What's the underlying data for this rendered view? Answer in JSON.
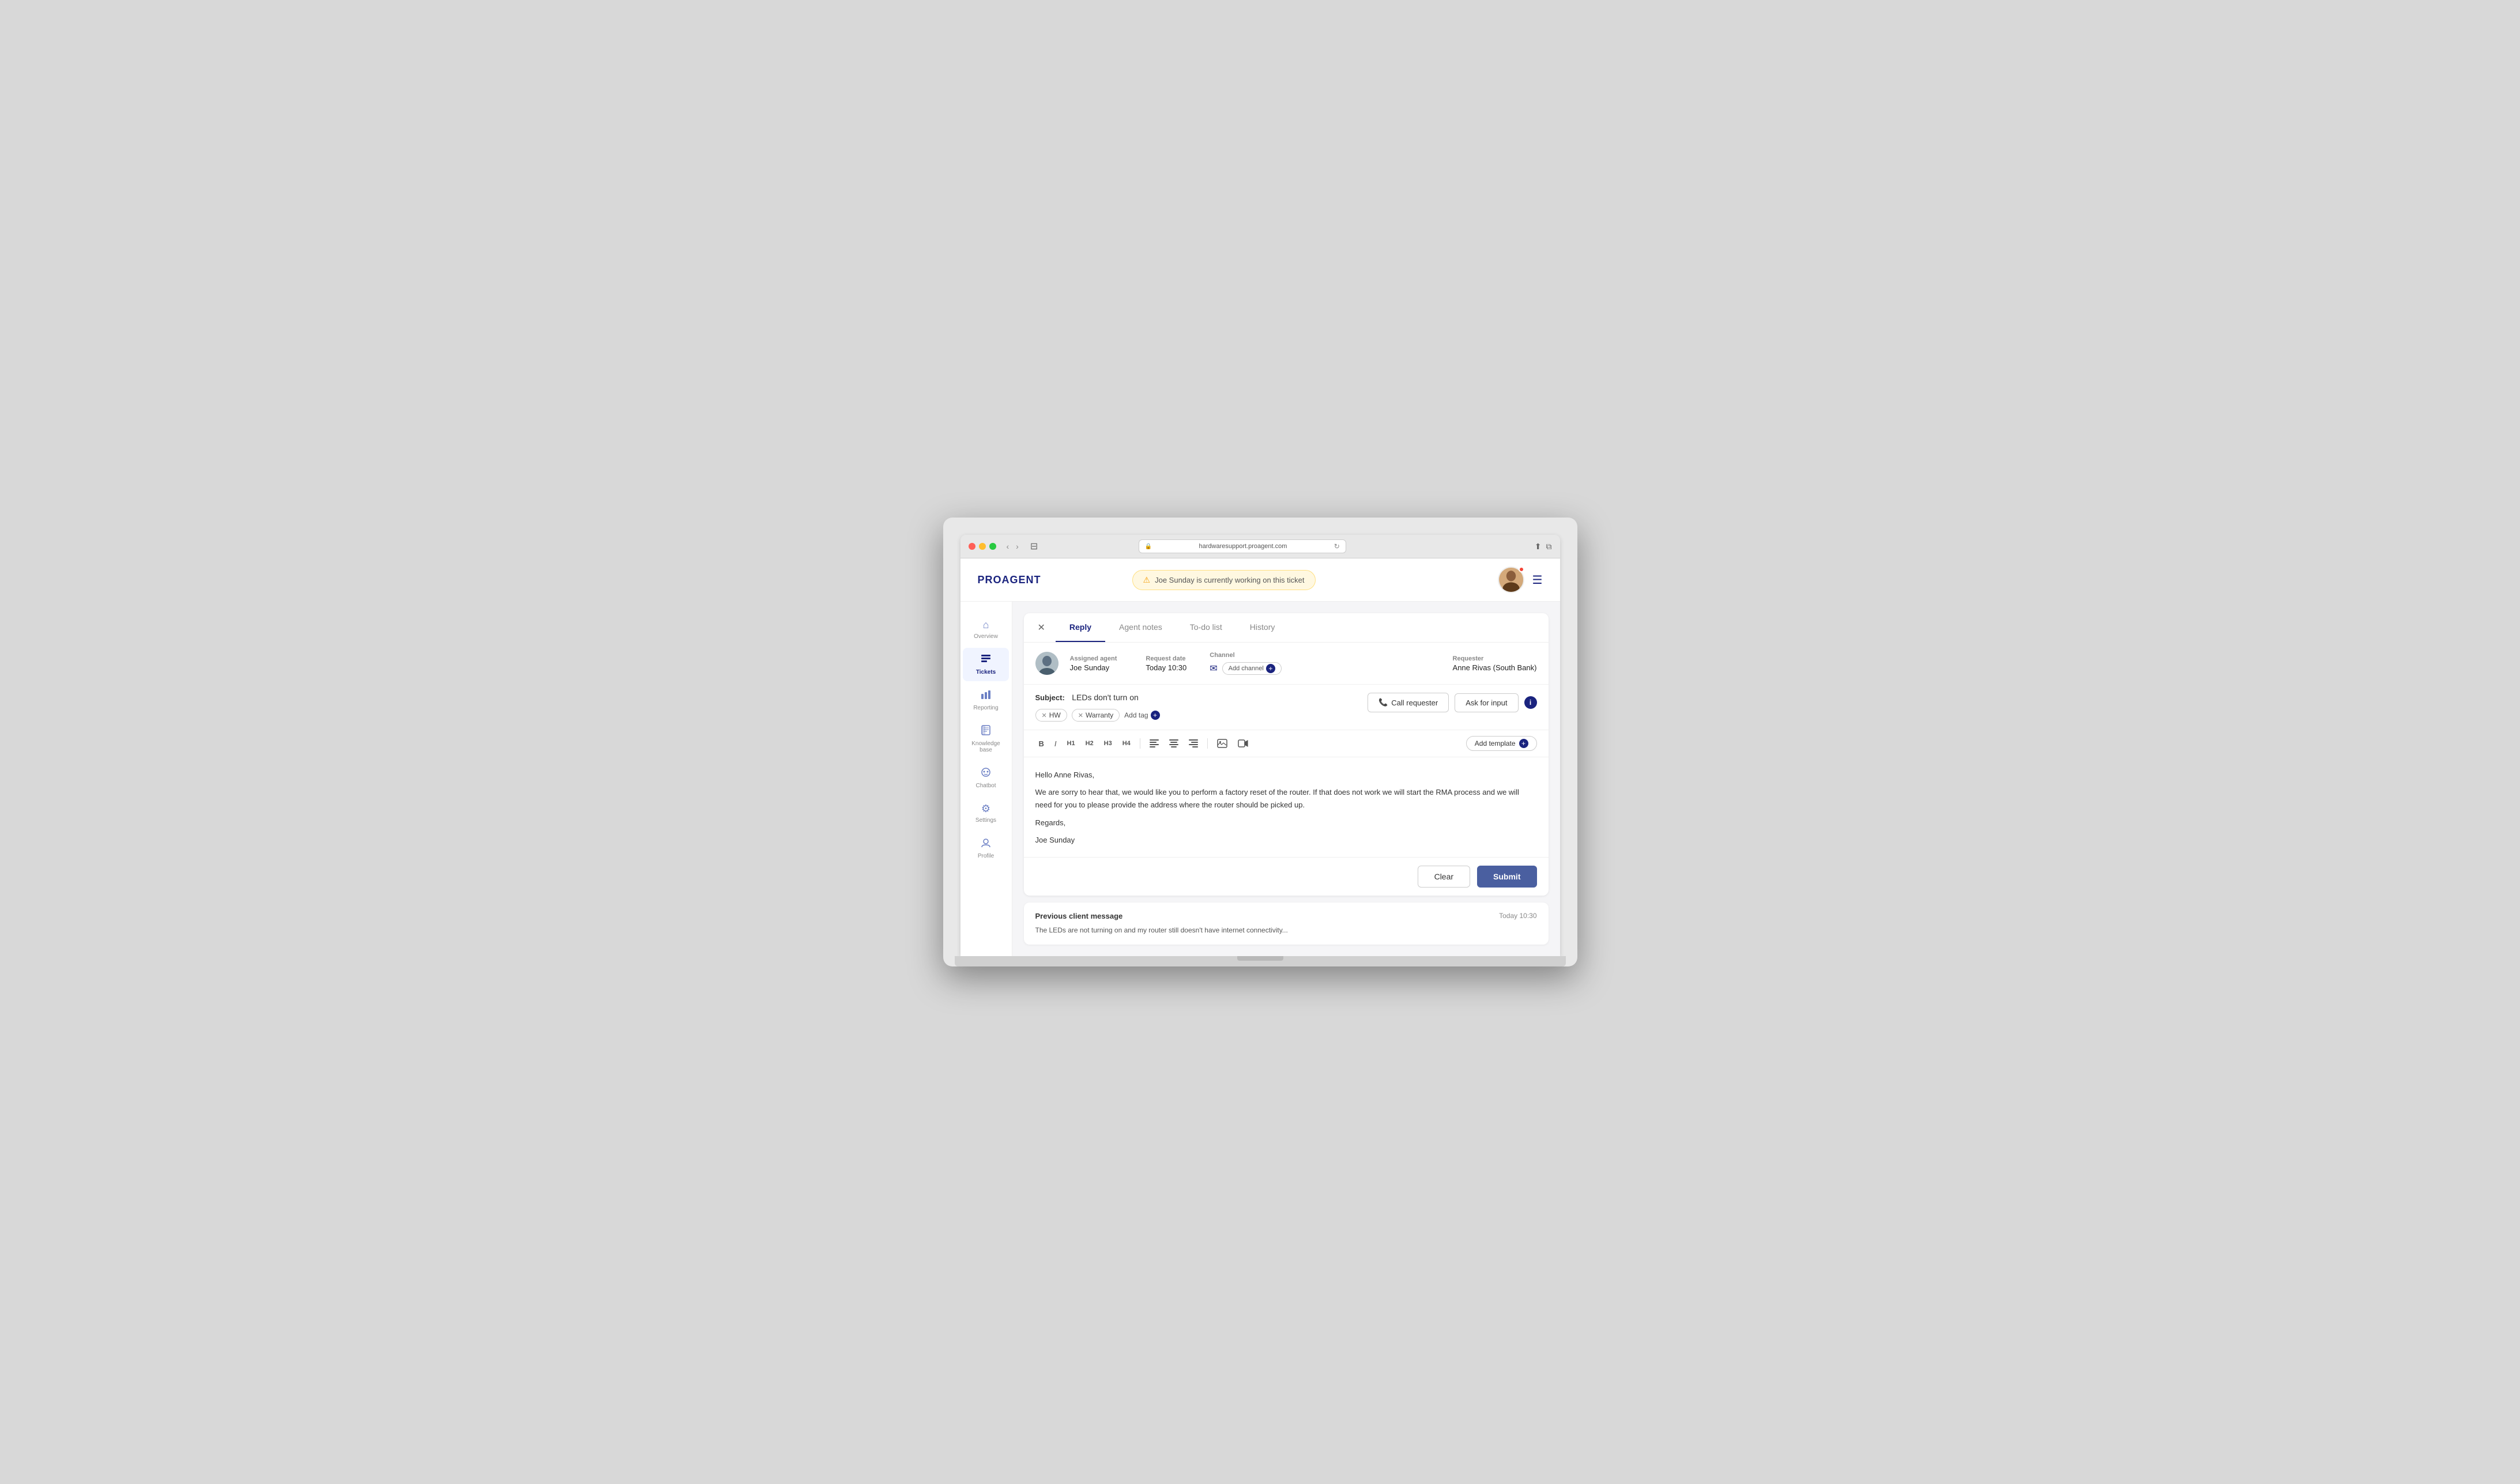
{
  "browser": {
    "url": "hardwaresupport.proagent.com"
  },
  "header": {
    "logo": "PROAGENT",
    "notification": "Joe Sunday is currently working on this ticket",
    "menu_icon": "☰"
  },
  "sidebar": {
    "items": [
      {
        "id": "overview",
        "label": "Overview",
        "icon": "⌂",
        "active": false
      },
      {
        "id": "tickets",
        "label": "Tickets",
        "icon": "☰",
        "active": true
      },
      {
        "id": "reporting",
        "label": "Reporting",
        "icon": "▦",
        "active": false
      },
      {
        "id": "knowledge-base",
        "label": "Knowledge base",
        "icon": "⊞",
        "active": false
      },
      {
        "id": "chatbot",
        "label": "Chatbot",
        "icon": "⊕",
        "active": false
      },
      {
        "id": "settings",
        "label": "Settings",
        "icon": "⚙",
        "active": false
      },
      {
        "id": "profile",
        "label": "Profile",
        "icon": "👤",
        "active": false
      }
    ]
  },
  "ticket": {
    "tabs": [
      {
        "id": "reply",
        "label": "Reply",
        "active": true
      },
      {
        "id": "agent-notes",
        "label": "Agent notes",
        "active": false
      },
      {
        "id": "todo-list",
        "label": "To-do list",
        "active": false
      },
      {
        "id": "history",
        "label": "History",
        "active": false
      }
    ],
    "assigned_agent_label": "Assigned agent",
    "assigned_agent": "Joe Sunday",
    "request_date_label": "Request date",
    "request_date": "Today 10:30",
    "channel_label": "Channel",
    "add_channel_label": "Add channel",
    "requester_label": "Requester",
    "requester": "Anne Rivas (South Bank)",
    "subject_label": "Subject:",
    "subject": "LEDs don't turn on",
    "tags": [
      "HW",
      "Warranty"
    ],
    "add_tag_label": "Add tag",
    "call_requester": "Call requester",
    "ask_for_input": "Ask for input",
    "toolbar": {
      "bold": "B",
      "italic": "I",
      "h1": "H1",
      "h2": "H2",
      "h3": "H3",
      "h4": "H4",
      "align_left": "≡",
      "align_center": "≡",
      "align_right": "≡",
      "image": "🖼",
      "video": "🎬",
      "add_template": "Add template"
    },
    "reply_body": {
      "greeting": "Hello Anne Rivas,",
      "body": "We are sorry to hear that, we would like you to perform a factory reset of the router.  If that does not work we will start the RMA process and we will need for you to please provide the address where the router should be picked up.",
      "closing": "Regards,",
      "signature": "Joe Sunday"
    },
    "clear_btn": "Clear",
    "submit_btn": "Submit",
    "previous_message_title": "Previous client message",
    "previous_message_time": "Today 10:30",
    "previous_message_text": "The LEDs are not turning on and my router still doesn't have internet connectivity..."
  }
}
